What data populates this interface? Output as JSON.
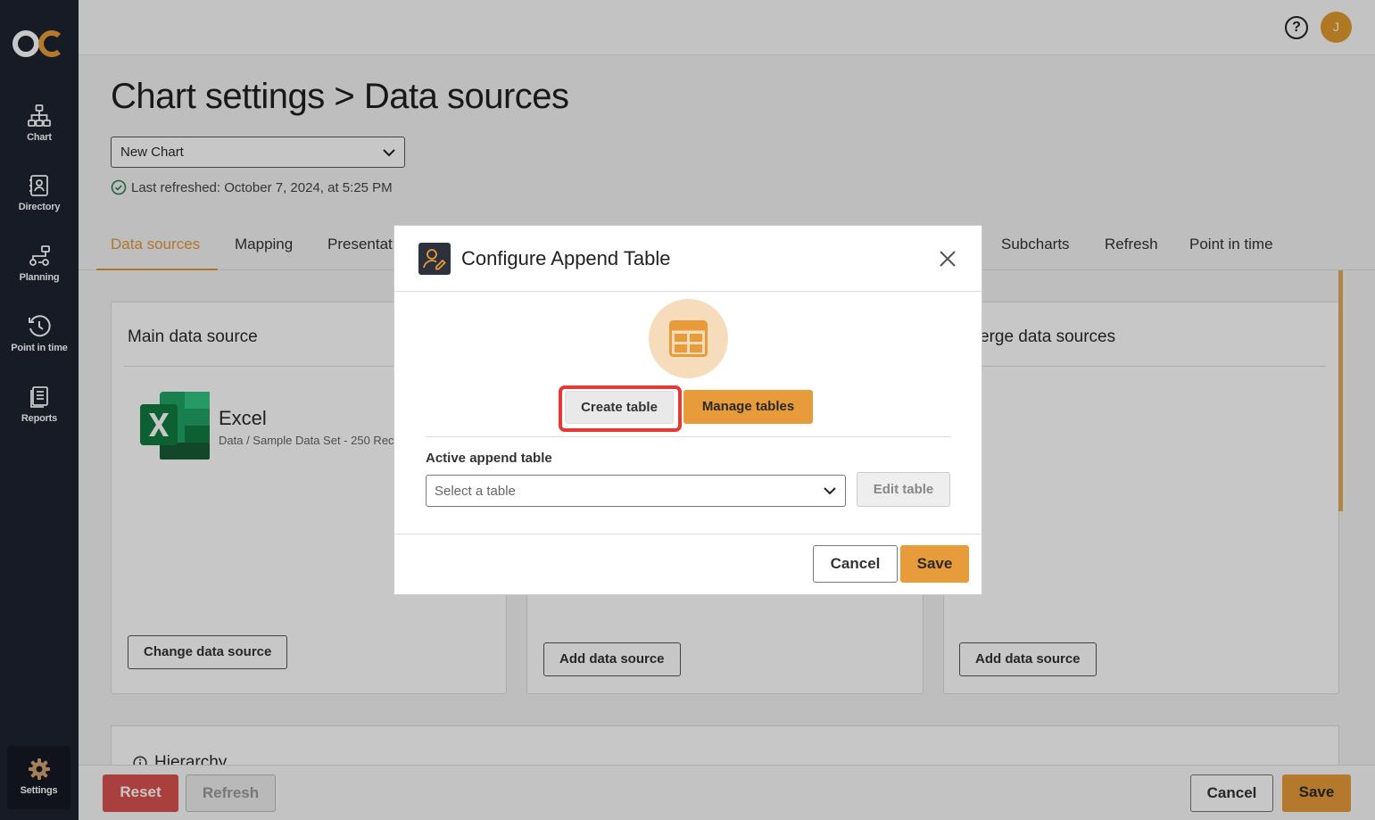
{
  "sidebar": {
    "logo": "OC",
    "items": [
      {
        "label": "Chart",
        "icon": "org-chart-icon"
      },
      {
        "label": "Directory",
        "icon": "directory-icon"
      },
      {
        "label": "Planning",
        "icon": "planning-icon"
      },
      {
        "label": "Point in time",
        "icon": "history-icon"
      },
      {
        "label": "Reports",
        "icon": "reports-icon"
      },
      {
        "label": "Settings",
        "icon": "gear-icon"
      }
    ]
  },
  "topbar": {
    "help": "?",
    "avatar_initial": "J"
  },
  "page": {
    "title": "Chart settings > Data sources",
    "chart_select_value": "New Chart",
    "last_refreshed": "Last refreshed: October 7, 2024, at 5:25 PM"
  },
  "tabs": [
    "Data sources",
    "Mapping",
    "Presentat",
    "Subcharts",
    "Refresh",
    "Point in time"
  ],
  "panels": {
    "main": {
      "title": "Main data source",
      "source_name": "Excel",
      "source_path": "Data / Sample Data Set - 250 Rec",
      "button": "Change data source"
    },
    "middle": {
      "button": "Add data source"
    },
    "merge": {
      "title": "erge data sources",
      "button": "Add data source"
    },
    "hierarchy": {
      "title": "Hierarchy"
    }
  },
  "bottombar": {
    "reset": "Reset",
    "refresh": "Refresh",
    "cancel": "Cancel",
    "save": "Save"
  },
  "modal": {
    "title": "Configure Append Table",
    "create_table": "Create table",
    "manage_tables": "Manage tables",
    "active_label": "Active append table",
    "select_placeholder": "Select a table",
    "edit_table": "Edit table",
    "cancel": "Cancel",
    "save": "Save"
  },
  "colors": {
    "accent": "#e89b3a",
    "sidebar": "#1e2330",
    "reset": "#d9534f",
    "highlight": "#e53935"
  }
}
